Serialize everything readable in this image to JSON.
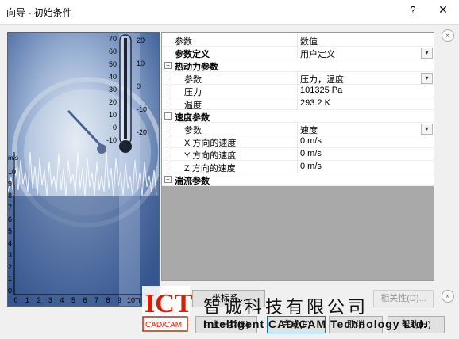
{
  "window": {
    "title": "向导 - 初始条件",
    "help_glyph": "?",
    "close_glyph": "✕"
  },
  "image": {
    "thermometer_left_ticks": [
      "70",
      "60",
      "50",
      "40",
      "30",
      "20",
      "10",
      "0",
      "-10"
    ],
    "thermometer_right_ticks": [
      "20",
      "10",
      "0",
      "-10",
      "-20"
    ],
    "y_axis_unit": "m/s",
    "y_axis_ticks": [
      "10",
      "9",
      "8",
      "7",
      "6",
      "5",
      "4",
      "3",
      "2",
      "1",
      "0"
    ],
    "x_axis_ticks": [
      "0",
      "1",
      "2",
      "3",
      "4",
      "5",
      "6",
      "7",
      "8",
      "9",
      "10"
    ],
    "x_axis_label": "Time, s"
  },
  "grid": {
    "header": {
      "name": "参数",
      "value": "数值"
    },
    "rows": {
      "param_def": {
        "name": "参数定义",
        "value": "用户定义"
      },
      "thermo": {
        "name": "热动力参数"
      },
      "thermo_param": {
        "name": "参数",
        "value": "压力，温度"
      },
      "pressure": {
        "name": "压力",
        "value": "101325 Pa"
      },
      "temperature": {
        "name": "温度",
        "value": "293.2 K"
      },
      "velocity": {
        "name": "速度参数"
      },
      "velocity_param": {
        "name": "参数",
        "value": "速度"
      },
      "vx": {
        "name": "X 方向的速度",
        "value": "0 m/s"
      },
      "vy": {
        "name": "Y 方向的速度",
        "value": "0 m/s"
      },
      "vz": {
        "name": "Z 方向的速度",
        "value": "0 m/s"
      },
      "turb": {
        "name": "湍流参数"
      }
    },
    "collapse_glyph": "−",
    "expand_glyph": "+",
    "dropdown_glyph": "▾"
  },
  "buttons": {
    "coord_system": "坐标系...",
    "dependency": "相关性(D)...",
    "back": "< 上一步(B)",
    "finish": "完成(F)",
    "cancel": "取消",
    "help": "帮助(H)",
    "scroll_up": "»",
    "scroll_down": "»"
  },
  "watermark": {
    "logo_letters": "ICT",
    "logo_sub": "CAD/CAM",
    "company_cn": "智诚科技有限公司",
    "company_en": "Intelligent CAD/CAM Technology Ltd."
  },
  "colors": {
    "brand_red": "#d81e06",
    "accent_blue": "#0078d7",
    "grid_grey": "#a9a9a9"
  }
}
